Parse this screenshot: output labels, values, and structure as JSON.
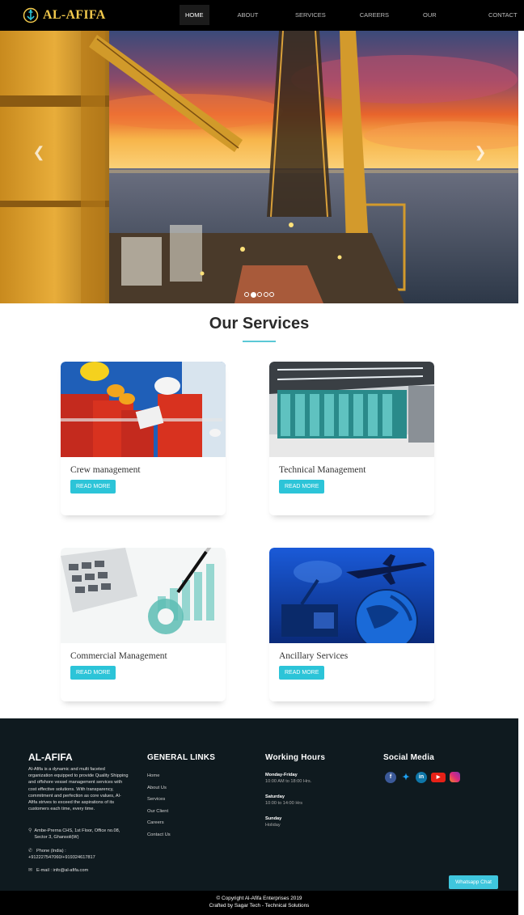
{
  "nav": {
    "brand": "AL-AFIFA",
    "items": [
      {
        "label": "HOME",
        "active": true
      },
      {
        "label": "ABOUT US"
      },
      {
        "label": "SERVICES"
      },
      {
        "label": "CAREERS"
      },
      {
        "label": "OUR CLIENTS"
      },
      {
        "label": "CONTACT US"
      }
    ]
  },
  "carousel": {
    "slide_count": 5,
    "active_slide": 2,
    "prev_icon": "chevron-left-icon",
    "next_icon": "chevron-right-icon"
  },
  "services": {
    "title": "Our Services",
    "cards": [
      {
        "title": "Crew management",
        "button": "READ MORE"
      },
      {
        "title": "Technical Management",
        "button": "READ MORE"
      },
      {
        "title": "Commercial Management",
        "button": "READ MORE"
      },
      {
        "title": "Ancillary Services",
        "button": "READ MORE"
      }
    ]
  },
  "footer": {
    "brand": "AL-AFIFA",
    "about": "Al-Afifa is a dynamic and multi faceted organization equipped to provide Quality Shipping and offshore vessel management services with cost effective solutions. With transparency, commitment and perfection as core values, Al-Afifa strives to exceed the aspirations of its customers each time, every time.",
    "address": "Ambe-Prerna CHS, 1st Floor, Office no.08, Sector 3, Ghansoli(W)",
    "phone_label": "Phone (India) :",
    "phone": "+912227547060/+919324617817",
    "email": "E-mail : info@al-afifa.com",
    "links_title": "GENERAL LINKS",
    "links": [
      "Home",
      "About Us",
      "Services",
      "Our Client",
      "Careers",
      "Contact Us"
    ],
    "hours_title": "Working Hours",
    "hours": [
      {
        "day": "Monday-Friday",
        "time": "10:00 AM to 18:00 Hrs."
      },
      {
        "day": "Saturday",
        "time": "10:00 to 14:00 Hrs"
      },
      {
        "day": "Sunday",
        "time": "Holiday"
      }
    ],
    "social_title": "Social Media",
    "social_icons": [
      "facebook-icon",
      "twitter-icon",
      "linkedin-icon",
      "youtube-icon",
      "instagram-icon"
    ]
  },
  "whatsapp": {
    "label": "Whatsapp Chat"
  },
  "copyright": {
    "line1": "© Copyright Al-Afifa Enterprises 2019",
    "line2": "Crafted by Sagar Tech - Technical Solutions"
  },
  "colors": {
    "accent": "#2cc4d8",
    "brand_gold": "#f2c94c",
    "footer_bg": "#0f1a1f",
    "nav_bg": "#000000"
  }
}
